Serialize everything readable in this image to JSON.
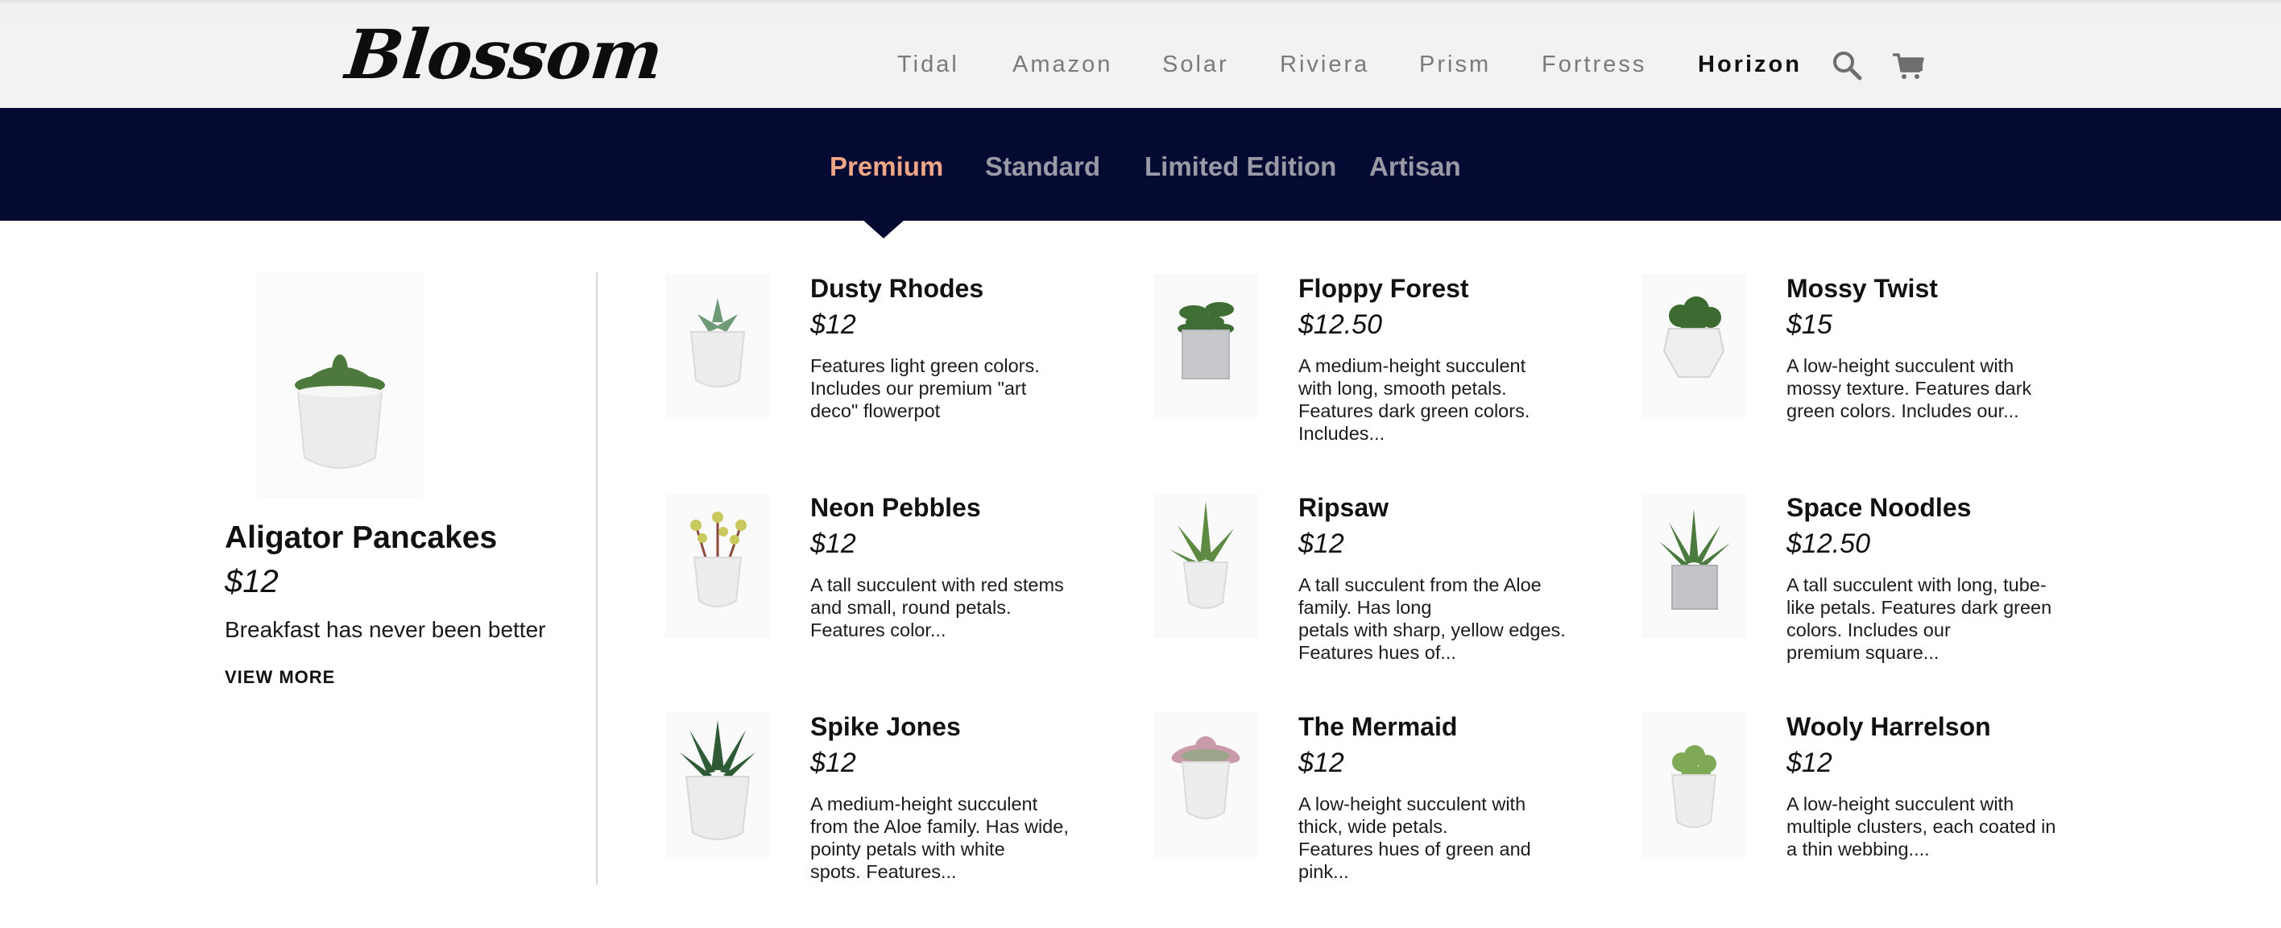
{
  "header": {
    "logo": "Blossom",
    "nav": [
      "Tidal",
      "Amazon",
      "Solar",
      "Riviera",
      "Prism",
      "Fortress",
      "Horizon"
    ],
    "active_nav": "Horizon",
    "icons": [
      "search-icon",
      "cart-icon"
    ]
  },
  "categories": {
    "items": [
      "Premium",
      "Standard",
      "Limited Edition",
      "Artisan"
    ],
    "active": "Premium"
  },
  "featured": {
    "title": "Aligator Pancakes",
    "price": "$12",
    "description": "Breakfast has never been better",
    "link": "VIEW MORE"
  },
  "products": [
    {
      "title": "Dusty Rhodes",
      "price": "$12",
      "description": "Features light green colors.\nIncludes our premium \"art\ndeco\" flowerpot"
    },
    {
      "title": "Floppy Forest",
      "price": "$12.50",
      "description": "A medium-height succulent\nwith long, smooth petals.\nFeatures dark green colors.\nIncludes..."
    },
    {
      "title": "Mossy Twist",
      "price": "$15",
      "description": "A low-height succulent with\nmossy texture. Features dark\ngreen colors. Includes our..."
    },
    {
      "title": "Neon Pebbles",
      "price": "$12",
      "description": "A tall succulent with red stems\nand small, round petals.\nFeatures color..."
    },
    {
      "title": "Ripsaw",
      "price": "$12",
      "description": "A tall succulent from the Aloe\nfamily. Has long\npetals with sharp, yellow edges.\nFeatures hues of..."
    },
    {
      "title": "Space Noodles",
      "price": "$12.50",
      "description": "A tall succulent with long, tube-\nlike petals. Features dark green\ncolors. Includes our\npremium square..."
    },
    {
      "title": "Spike Jones",
      "price": "$12",
      "description": "A medium-height succulent\nfrom the Aloe family. Has wide,\npointy petals with white\nspots. Features..."
    },
    {
      "title": "The Mermaid",
      "price": "$12",
      "description": "A low-height succulent with\nthick, wide petals.\nFeatures hues of green and\npink..."
    },
    {
      "title": "Wooly Harrelson",
      "price": "$12",
      "description": "A low-height succulent with\nmultiple clusters, each coated in\na thin webbing...."
    }
  ],
  "colors": {
    "category_bar": "#050a33",
    "active_category": "#efa786",
    "inactive_category": "#9a9aa6"
  }
}
